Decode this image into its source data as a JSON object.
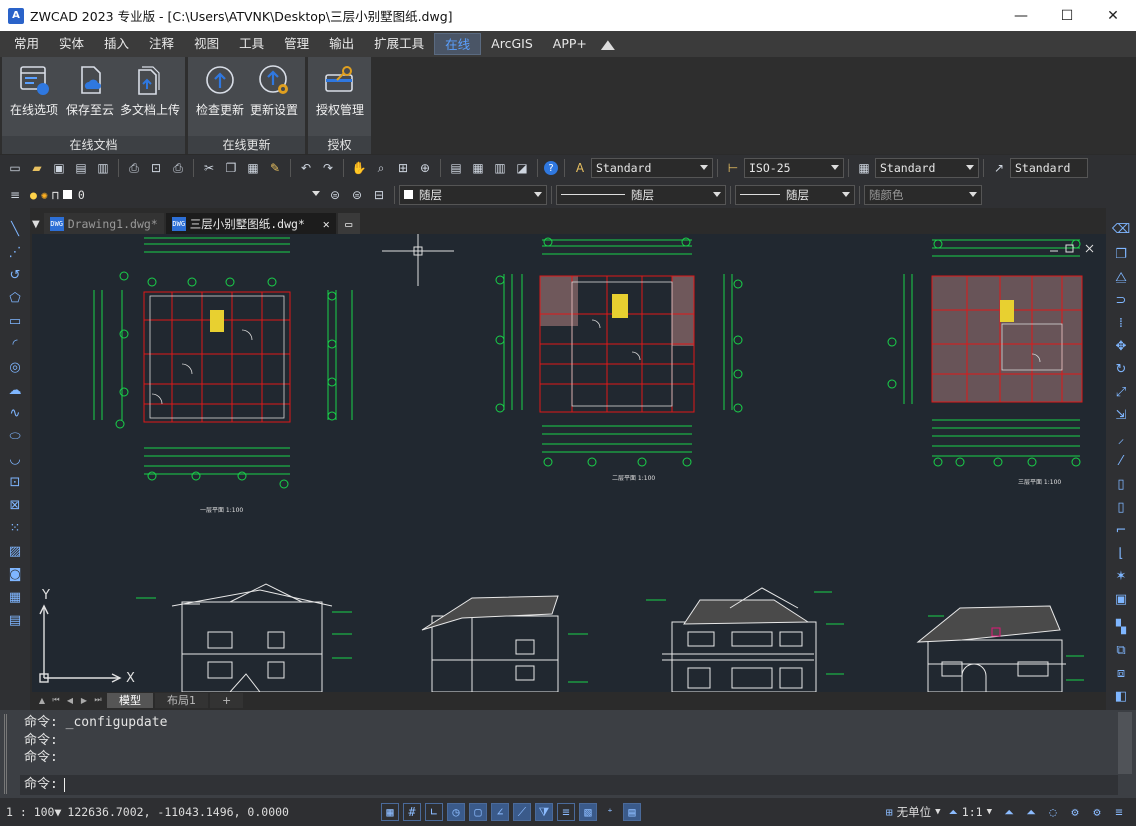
{
  "window": {
    "title": "ZWCAD 2023 专业版 - [C:\\Users\\ATVNK\\Desktop\\三层小别墅图纸.dwg]",
    "logo": "A",
    "minimize": "—",
    "maximize": "☐",
    "close": "✕"
  },
  "menu": {
    "tabs": [
      "常用",
      "实体",
      "插入",
      "注释",
      "视图",
      "工具",
      "管理",
      "输出",
      "扩展工具",
      "在线",
      "ArcGIS",
      "APP+"
    ],
    "active": "在线"
  },
  "ribbon": {
    "groups": [
      {
        "title": "在线文档",
        "buttons": [
          "在线选项",
          "保存至云",
          "多文档上传"
        ]
      },
      {
        "title": "在线更新",
        "buttons": [
          "检查更新",
          "更新设置"
        ]
      },
      {
        "title": "授权",
        "buttons": [
          "授权管理"
        ]
      }
    ]
  },
  "toolbar": {
    "text_style": "Standard",
    "dim_style": "ISO-25",
    "table_style": "Standard",
    "mleader_style": "Standard",
    "layer_value": "0",
    "color_value": "随层",
    "linetype_value": "随层",
    "lineweight_value": "随层",
    "plotstyle_value": "随颜色"
  },
  "doc_tabs": {
    "tab1": "Drawing1.dwg*",
    "tab2": "三层小别墅图纸.dwg*",
    "close": "✕"
  },
  "drawing": {
    "plan1_caption": "一层平面 1:100",
    "plan2_caption": "二层平面 1:100",
    "plan3_caption": "三层平面 1:100",
    "ucs_x": "X",
    "ucs_y": "Y"
  },
  "layout_tabs": {
    "model": "模型",
    "layout1": "布局1",
    "add": "+"
  },
  "command": {
    "line1": "命令: _configupdate",
    "line2": "命令:",
    "line3": "命令:",
    "prompt": "命令:"
  },
  "status": {
    "scale": "1 : 100",
    "coords": "122636.7002, -11043.1496, 0.0000",
    "units": "无单位",
    "anno_scale": "1:1"
  }
}
